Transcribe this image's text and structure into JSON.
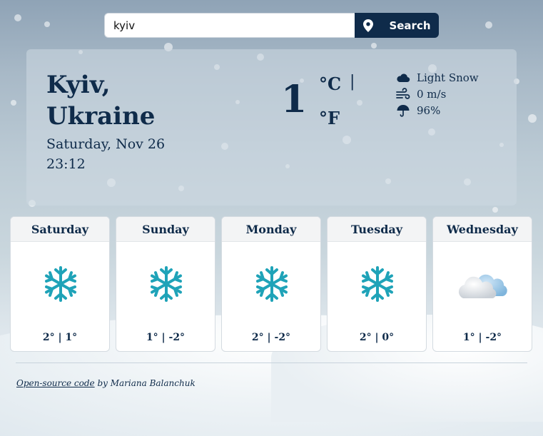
{
  "search": {
    "value": "kyiv",
    "button_label": "Search"
  },
  "current": {
    "city": "Kyiv, Ukraine",
    "date": "Saturday, Nov 26",
    "time": "23:12",
    "temperature": "1",
    "unit_celsius": "°C",
    "unit_separator": "|",
    "unit_fahrenheit": "°F",
    "condition": "Light Snow",
    "wind": "0 m/s",
    "humidity": "96%"
  },
  "forecast": [
    {
      "day": "Saturday",
      "temps": "2° | 1°",
      "icon": "snowflake-icon"
    },
    {
      "day": "Sunday",
      "temps": "1° | -2°",
      "icon": "snowflake-icon"
    },
    {
      "day": "Monday",
      "temps": "2° | -2°",
      "icon": "snowflake-icon"
    },
    {
      "day": "Tuesday",
      "temps": "2° | 0°",
      "icon": "snowflake-icon"
    },
    {
      "day": "Wednesday",
      "temps": "1° | -2°",
      "icon": "cloudy-icon"
    }
  ],
  "footer": {
    "link_text": "Open-source code",
    "author_text": " by Mariana Balanchuk"
  },
  "colors": {
    "accent": "#0f2b4a",
    "snowflake": "#1fa3b8"
  }
}
